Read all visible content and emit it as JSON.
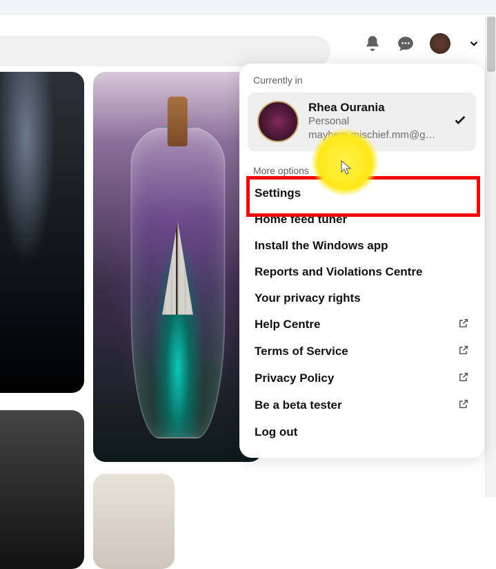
{
  "header": {
    "bell_icon": "notifications-icon",
    "chat_icon": "messages-icon",
    "avatar": "profile-avatar",
    "chevron": "account-menu-chevron"
  },
  "dropdown": {
    "currently_label": "Currently in",
    "profile": {
      "name": "Rhea Ourania",
      "type": "Personal",
      "email": "mayhem.mischief.mm@g…"
    },
    "more_label": "More options",
    "items": [
      {
        "label": "Settings",
        "external": false,
        "highlighted": true
      },
      {
        "label": "Home feed tuner",
        "external": false
      },
      {
        "label": "Install the Windows app",
        "external": false
      },
      {
        "label": "Reports and Violations Centre",
        "external": false
      },
      {
        "label": "Your privacy rights",
        "external": false
      },
      {
        "label": "Help Centre",
        "external": true
      },
      {
        "label": "Terms of Service",
        "external": true
      },
      {
        "label": "Privacy Policy",
        "external": true
      },
      {
        "label": "Be a beta tester",
        "external": true
      },
      {
        "label": "Log out",
        "external": false
      }
    ]
  },
  "annotation": {
    "highlight_color": "#ef0707",
    "cursor_highlight_color": "#fff24a"
  }
}
